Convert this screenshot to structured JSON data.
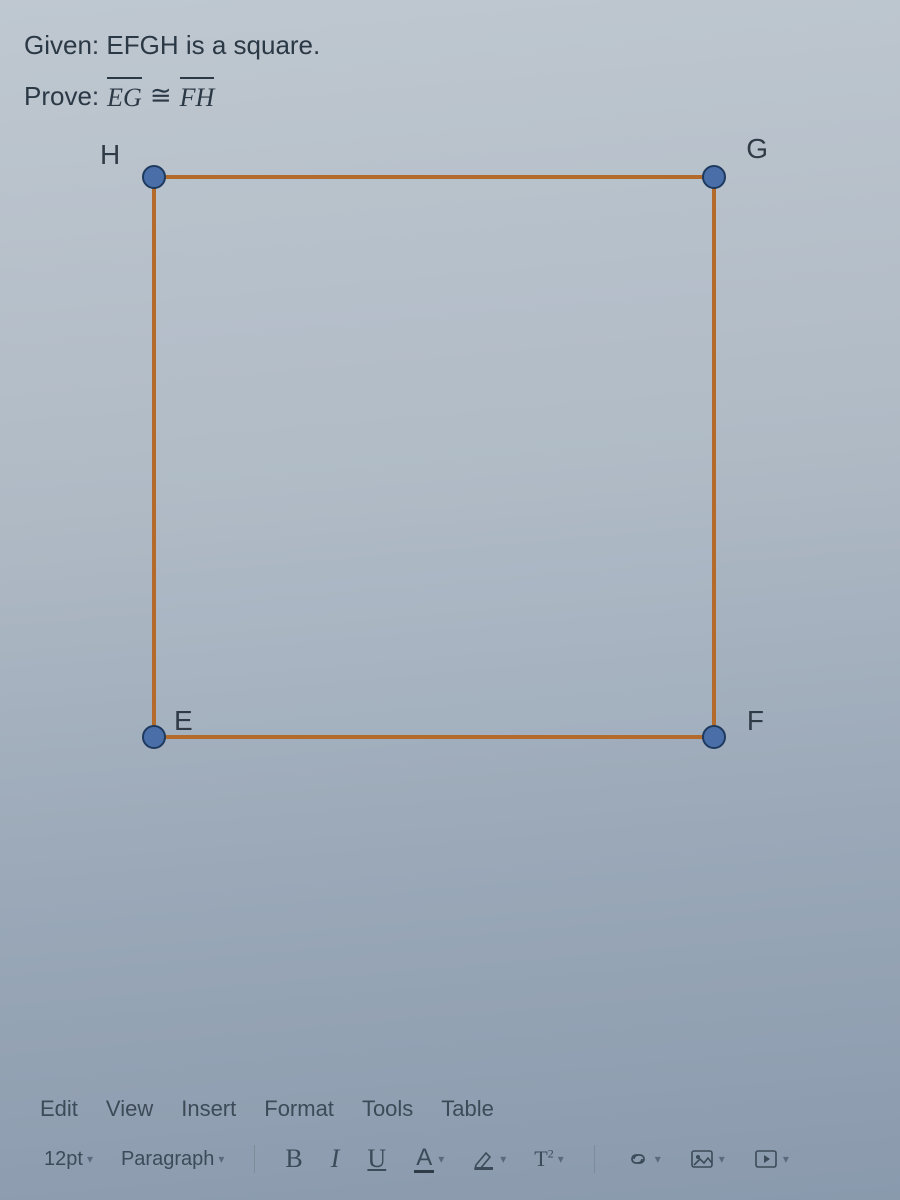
{
  "question": {
    "given_label": "Given:",
    "given_text": "EFGH is a square.",
    "prove_label": "Prove:",
    "segment1": "EG",
    "congruent": "≅",
    "segment2": "FH",
    "vertices": {
      "H": "H",
      "G": "G",
      "E": "E",
      "F": "F"
    }
  },
  "editor": {
    "menu": [
      "Edit",
      "View",
      "Insert",
      "Format",
      "Tools",
      "Table"
    ],
    "font_size": "12pt",
    "block_format": "Paragraph",
    "buttons": {
      "bold": "B",
      "italic": "I",
      "underline": "U",
      "text_color": "A",
      "highlight": "highlight",
      "superscript": "T²",
      "link": "link",
      "image": "image",
      "media": "media"
    }
  }
}
